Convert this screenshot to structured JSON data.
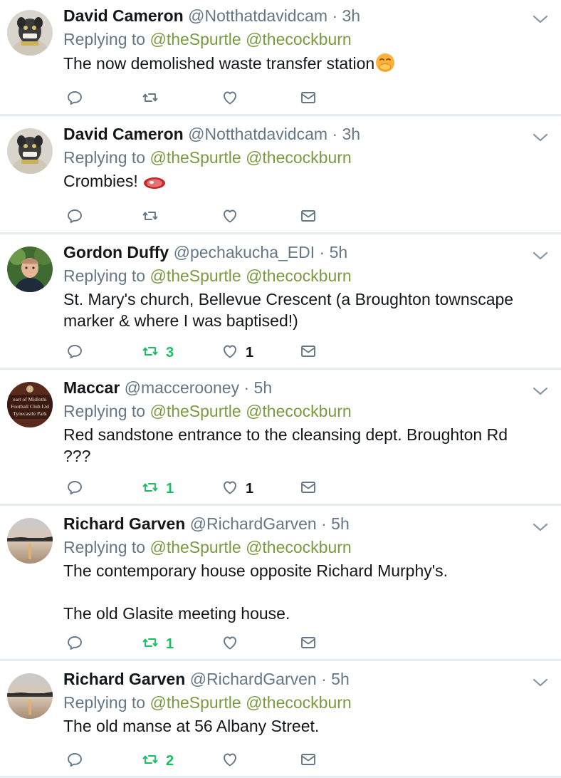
{
  "replying_label": "Replying to",
  "tweets": [
    {
      "name": "David Cameron",
      "handle": "@Notthatdavidcam",
      "dot": "·",
      "time": "3h",
      "mentions": [
        "@theSpurtle",
        "@thecockburn"
      ],
      "text": "The now demolished waste transfer station",
      "emoji": "hand-over-mouth-emoji",
      "avatar": "dog-statue-avatar",
      "retweets": "",
      "likes": ""
    },
    {
      "name": "David Cameron",
      "handle": "@Notthatdavidcam",
      "dot": "·",
      "time": "3h",
      "mentions": [
        "@theSpurtle",
        "@thecockburn"
      ],
      "text": "Crombies! ",
      "emoji": "steak-emoji",
      "avatar": "dog-statue-avatar",
      "retweets": "",
      "likes": ""
    },
    {
      "name": "Gordon Duffy",
      "handle": "@pechakucha_EDI",
      "dot": "·",
      "time": "5h",
      "mentions": [
        "@theSpurtle",
        "@thecockburn"
      ],
      "text": "St. Mary's church, Bellevue Crescent (a Broughton townscape\nmarker & where I was baptised!)",
      "avatar": "portrait-avatar",
      "retweets": "3",
      "likes": "1"
    },
    {
      "name": "Maccar",
      "handle": "@maccerooney",
      "dot": "·",
      "time": "5h",
      "mentions": [
        "@theSpurtle",
        "@thecockburn"
      ],
      "text": "Red sandstone entrance to the cleansing dept. Broughton Rd\n???",
      "avatar": "club-sign-avatar",
      "avatar_text": [
        "eart of Midlothi",
        "Football Club Ltd",
        "Tynecastle Park"
      ],
      "retweets": "1",
      "likes": "1"
    },
    {
      "name": "Richard Garven",
      "handle": "@RichardGarven",
      "dot": "·",
      "time": "5h",
      "mentions": [
        "@theSpurtle",
        "@thecockburn"
      ],
      "text": "The contemporary house opposite Richard Murphy's.\n\nThe old Glasite meeting house.",
      "avatar": "sunset-lake-avatar",
      "retweets": "1",
      "likes": ""
    },
    {
      "name": "Richard Garven",
      "handle": "@RichardGarven",
      "dot": "·",
      "time": "5h",
      "mentions": [
        "@theSpurtle",
        "@thecockburn"
      ],
      "text": "The old manse at 56 Albany Street.",
      "avatar": "sunset-lake-avatar",
      "retweets": "2",
      "likes": ""
    }
  ],
  "colors": {
    "text": "#14171a",
    "muted": "#657786",
    "mention": "#7a9a3f",
    "retweet_active": "#17bf63",
    "divider": "#e6ecf0"
  }
}
